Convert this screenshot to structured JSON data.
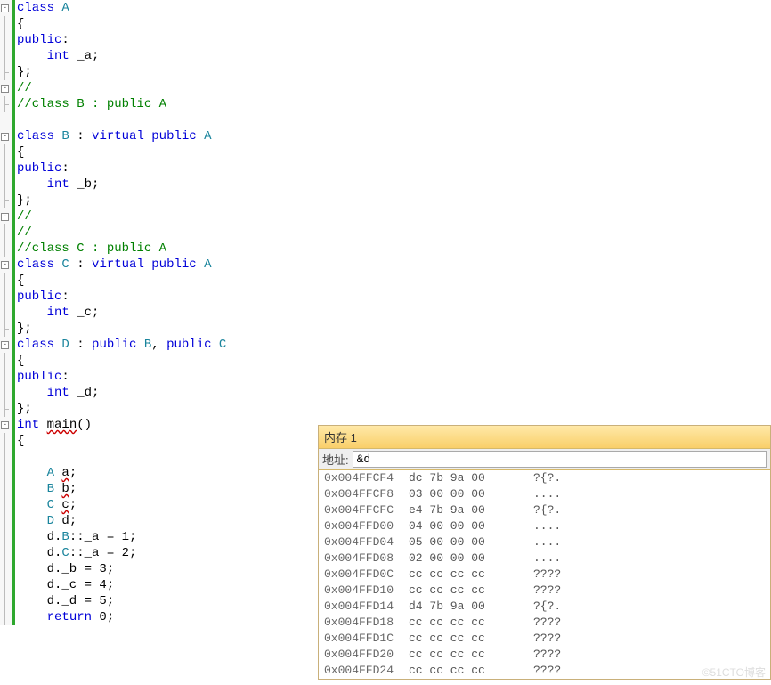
{
  "code": {
    "lines": [
      {
        "fold": "box",
        "html": "<span class='kw'>class</span> <span class='typecolor'>A</span>"
      },
      {
        "fold": "line",
        "html": "{"
      },
      {
        "fold": "line",
        "html": "<span class='kw'>public</span>:"
      },
      {
        "fold": "line",
        "html": "    <span class='kw'>int</span> _a;"
      },
      {
        "fold": "end",
        "html": "};"
      },
      {
        "fold": "box",
        "html": "<span class='com'>//</span>"
      },
      {
        "fold": "end",
        "html": "<span class='com'>//class B : public A</span>"
      },
      {
        "fold": "none",
        "html": ""
      },
      {
        "fold": "box",
        "html": "<span class='kw'>class</span> <span class='typecolor'>B</span> : <span class='kw'>virtual</span> <span class='kw'>public</span> <span class='typecolor'>A</span>"
      },
      {
        "fold": "line",
        "html": "{"
      },
      {
        "fold": "line",
        "html": "<span class='kw'>public</span>:"
      },
      {
        "fold": "line",
        "html": "    <span class='kw'>int</span> _b;"
      },
      {
        "fold": "end",
        "html": "};"
      },
      {
        "fold": "box",
        "html": "<span class='com'>//</span>"
      },
      {
        "fold": "line",
        "html": "<span class='com'>//</span>"
      },
      {
        "fold": "end",
        "html": "<span class='com'>//class C : public A</span>"
      },
      {
        "fold": "box",
        "html": "<span class='kw'>class</span> <span class='typecolor'>C</span> : <span class='kw'>virtual</span> <span class='kw'>public</span> <span class='typecolor'>A</span>"
      },
      {
        "fold": "line",
        "html": "{"
      },
      {
        "fold": "line",
        "html": "<span class='kw'>public</span>:"
      },
      {
        "fold": "line",
        "html": "    <span class='kw'>int</span> _c;"
      },
      {
        "fold": "end",
        "html": "};"
      },
      {
        "fold": "box",
        "html": "<span class='kw'>class</span> <span class='typecolor'>D</span> : <span class='kw'>public</span> <span class='typecolor'>B</span>, <span class='kw'>public</span> <span class='typecolor'>C</span>"
      },
      {
        "fold": "line",
        "html": "{"
      },
      {
        "fold": "line",
        "html": "<span class='kw'>public</span>:"
      },
      {
        "fold": "line",
        "html": "    <span class='kw'>int</span> _d;"
      },
      {
        "fold": "end",
        "html": "};"
      },
      {
        "fold": "box",
        "html": "<span class='kw'>int</span> <span class='squiggle'>main</span>()"
      },
      {
        "fold": "line",
        "html": "{"
      },
      {
        "fold": "line",
        "html": ""
      },
      {
        "fold": "line",
        "html": "    <span class='typecolor'>A</span> <span class='squiggle'>a</span>;"
      },
      {
        "fold": "line",
        "html": "    <span class='typecolor'>B</span> <span class='squiggle'>b</span>;"
      },
      {
        "fold": "line",
        "html": "    <span class='typecolor'>C</span> <span class='squiggle'>c</span>;"
      },
      {
        "fold": "line",
        "html": "    <span class='typecolor'>D</span> d;"
      },
      {
        "fold": "line",
        "html": "    d.<span class='typecolor'>B</span>::_a = 1;"
      },
      {
        "fold": "line",
        "html": "    d.<span class='typecolor'>C</span>::_a = 2;"
      },
      {
        "fold": "line",
        "html": "    d._b = 3;"
      },
      {
        "fold": "line",
        "html": "    d._c = 4;"
      },
      {
        "fold": "line",
        "html": "    d._d = 5;"
      },
      {
        "fold": "line",
        "html": "    <span class='kw'>return</span> 0;"
      }
    ]
  },
  "memory": {
    "title": "内存 1",
    "addr_label": "地址:",
    "addr_value": "&d",
    "rows": [
      {
        "addr": "0x004FFCF4",
        "hex": "dc 7b 9a 00",
        "ascii": "?{?."
      },
      {
        "addr": "0x004FFCF8",
        "hex": "03 00 00 00",
        "ascii": "...."
      },
      {
        "addr": "0x004FFCFC",
        "hex": "e4 7b 9a 00",
        "ascii": "?{?."
      },
      {
        "addr": "0x004FFD00",
        "hex": "04 00 00 00",
        "ascii": "...."
      },
      {
        "addr": "0x004FFD04",
        "hex": "05 00 00 00",
        "ascii": "...."
      },
      {
        "addr": "0x004FFD08",
        "hex": "02 00 00 00",
        "ascii": "...."
      },
      {
        "addr": "0x004FFD0C",
        "hex": "cc cc cc cc",
        "ascii": "????"
      },
      {
        "addr": "0x004FFD10",
        "hex": "cc cc cc cc",
        "ascii": "????"
      },
      {
        "addr": "0x004FFD14",
        "hex": "d4 7b 9a 00",
        "ascii": "?{?."
      },
      {
        "addr": "0x004FFD18",
        "hex": "cc cc cc cc",
        "ascii": "????"
      },
      {
        "addr": "0x004FFD1C",
        "hex": "cc cc cc cc",
        "ascii": "????"
      },
      {
        "addr": "0x004FFD20",
        "hex": "cc cc cc cc",
        "ascii": "????"
      },
      {
        "addr": "0x004FFD24",
        "hex": "cc cc cc cc",
        "ascii": "????"
      }
    ]
  },
  "watermark": "©51CTO博客"
}
